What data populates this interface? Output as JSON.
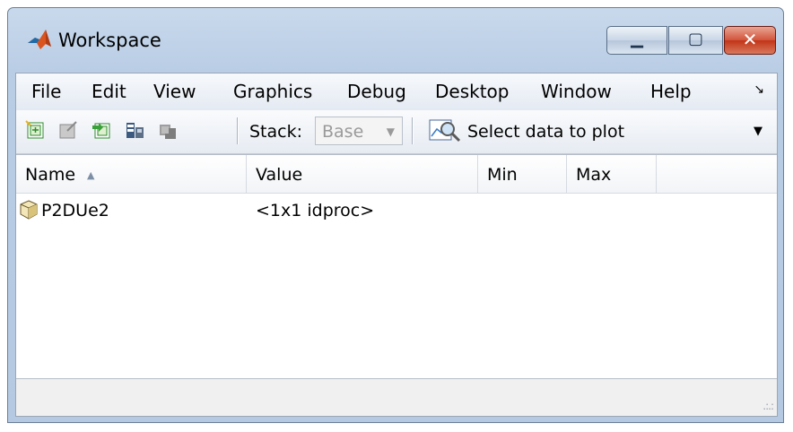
{
  "window": {
    "title": "Workspace"
  },
  "menu": [
    "File",
    "Edit",
    "View",
    "Graphics",
    "Debug",
    "Desktop",
    "Window",
    "Help"
  ],
  "toolbar": {
    "icons": [
      "new-variable-icon",
      "open-variable-icon",
      "import-data-icon",
      "save-workspace-icon",
      "delete-variable-icon"
    ],
    "stack_label": "Stack:",
    "stack_value": "Base",
    "plot_label": "Select data to plot"
  },
  "table": {
    "columns": [
      "Name",
      "Value",
      "Min",
      "Max"
    ],
    "sort_column": "Name",
    "rows": [
      {
        "name": "P2DUe2",
        "value": "<1x1 idproc>",
        "min": "",
        "max": ""
      }
    ]
  },
  "colors": {
    "titlebar": "#b9cde5",
    "close": "#c13417"
  }
}
